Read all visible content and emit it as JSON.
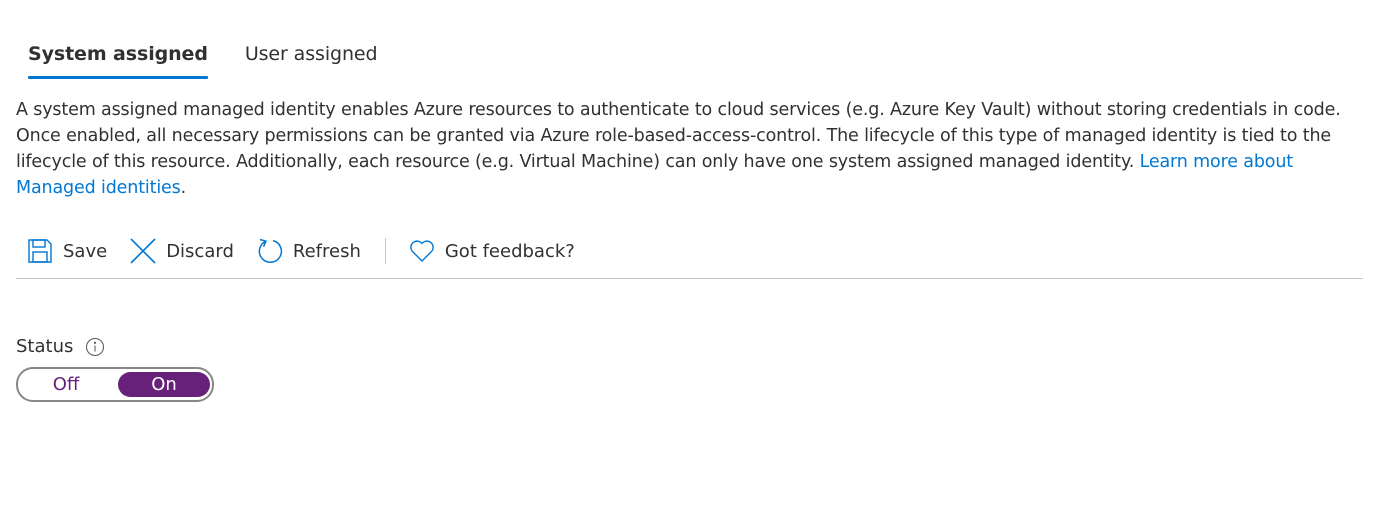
{
  "tabs": [
    {
      "label": "System assigned",
      "active": true
    },
    {
      "label": "User assigned",
      "active": false
    }
  ],
  "description": {
    "text": "A system assigned managed identity enables Azure resources to authenticate to cloud services (e.g. Azure Key Vault) without storing credentials in code. Once enabled, all necessary permissions can be granted via Azure role-based-access-control. The lifecycle of this type of managed identity is tied to the lifecycle of this resource. Additionally, each resource (e.g. Virtual Machine) can only have one system assigned managed identity. ",
    "link_text": "Learn more about Managed identities",
    "link_trailing": "."
  },
  "toolbar": {
    "save_label": "Save",
    "discard_label": "Discard",
    "refresh_label": "Refresh",
    "feedback_label": "Got feedback?"
  },
  "icons": {
    "save": "save-icon",
    "discard": "close-icon",
    "refresh": "refresh-icon",
    "feedback": "heart-icon",
    "info": "info-icon"
  },
  "status": {
    "label": "Status",
    "off_label": "Off",
    "on_label": "On",
    "selected": "On"
  },
  "colors": {
    "accent": "#0078d4",
    "toggle_selected": "#68217a",
    "text": "#323130",
    "border": "#c8c6c4"
  }
}
